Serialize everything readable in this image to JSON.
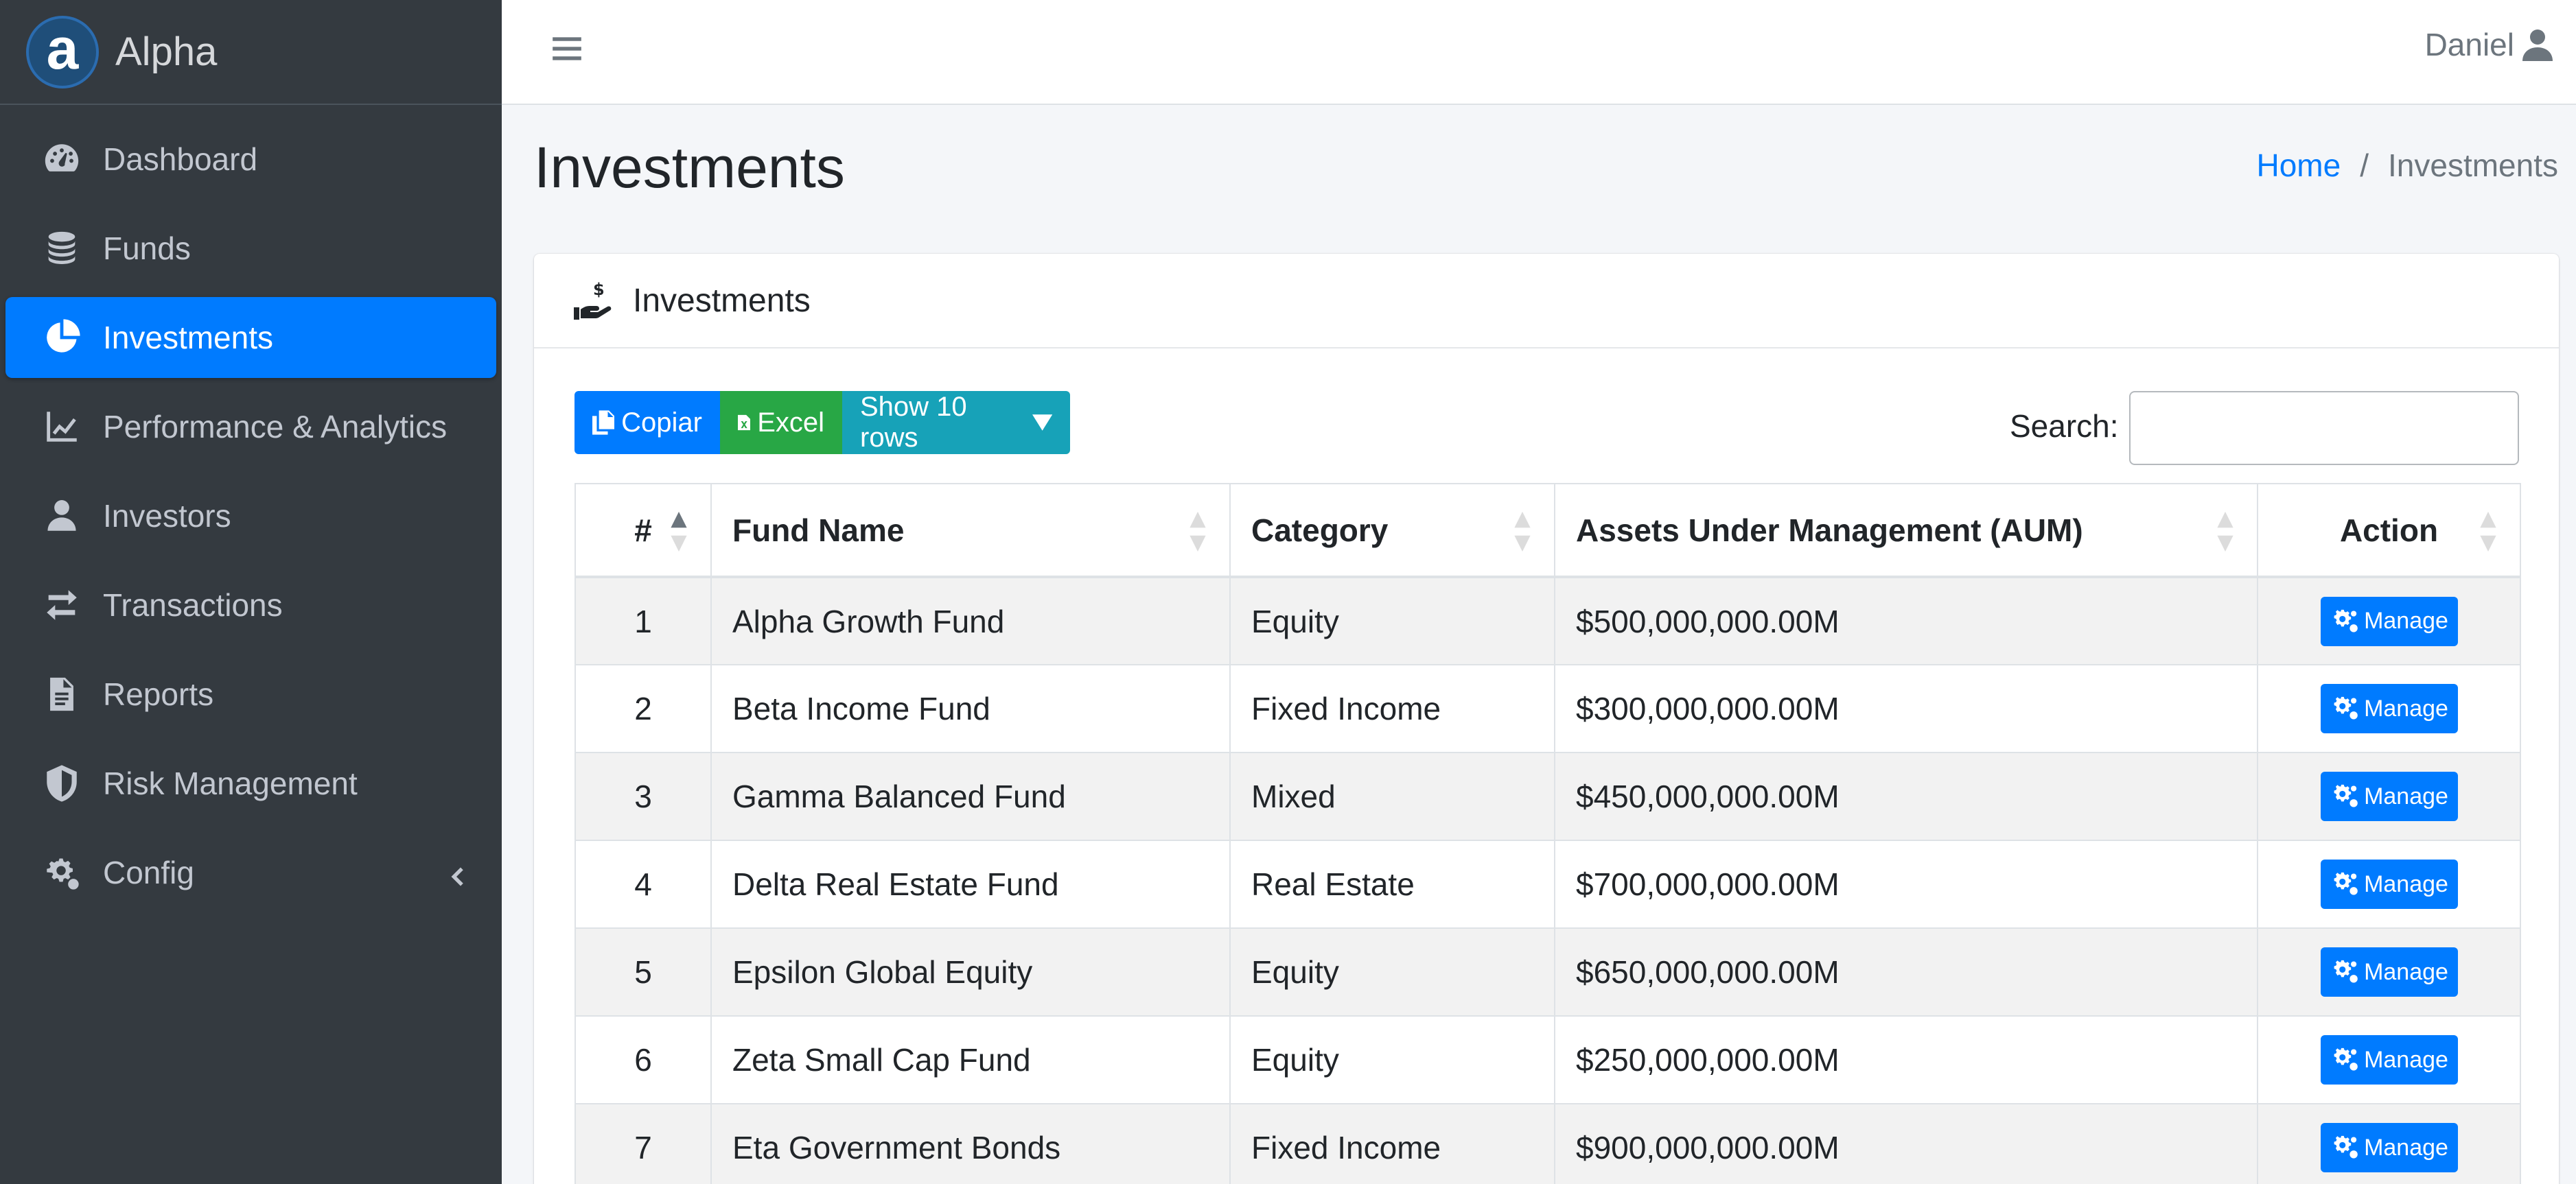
{
  "brand": {
    "letter": "a",
    "name": "Alpha"
  },
  "sidebar": {
    "items": [
      {
        "label": "Dashboard",
        "icon": "tachometer-icon"
      },
      {
        "label": "Funds",
        "icon": "coins-icon"
      },
      {
        "label": "Investments",
        "icon": "pie-chart-icon",
        "active": true
      },
      {
        "label": "Performance & Analytics",
        "icon": "line-chart-icon"
      },
      {
        "label": "Investors",
        "icon": "user-icon"
      },
      {
        "label": "Transactions",
        "icon": "exchange-icon"
      },
      {
        "label": "Reports",
        "icon": "file-icon"
      },
      {
        "label": "Risk Management",
        "icon": "shield-icon"
      },
      {
        "label": "Config",
        "icon": "gears-icon",
        "has_submenu": true
      }
    ]
  },
  "topbar": {
    "user_name": "Daniel"
  },
  "page": {
    "title": "Investments"
  },
  "breadcrumb": {
    "home": "Home",
    "separator": "/",
    "current": "Investments"
  },
  "card": {
    "title": "Investments"
  },
  "toolbar": {
    "copy_label": "Copiar",
    "excel_label": "Excel",
    "rows_label": "Show 10 rows"
  },
  "search": {
    "label": "Search:",
    "value": "",
    "placeholder": ""
  },
  "table": {
    "headers": [
      "#",
      "Fund Name",
      "Category",
      "Assets Under Management (AUM)",
      "Action"
    ],
    "rows": [
      {
        "num": "1",
        "fund": "Alpha Growth Fund",
        "category": "Equity",
        "aum": "$500,000,000.00M",
        "action": "Manage"
      },
      {
        "num": "2",
        "fund": "Beta Income Fund",
        "category": "Fixed Income",
        "aum": "$300,000,000.00M",
        "action": "Manage"
      },
      {
        "num": "3",
        "fund": "Gamma Balanced Fund",
        "category": "Mixed",
        "aum": "$450,000,000.00M",
        "action": "Manage"
      },
      {
        "num": "4",
        "fund": "Delta Real Estate Fund",
        "category": "Real Estate",
        "aum": "$700,000,000.00M",
        "action": "Manage"
      },
      {
        "num": "5",
        "fund": "Epsilon Global Equity",
        "category": "Equity",
        "aum": "$650,000,000.00M",
        "action": "Manage"
      },
      {
        "num": "6",
        "fund": "Zeta Small Cap Fund",
        "category": "Equity",
        "aum": "$250,000,000.00M",
        "action": "Manage"
      },
      {
        "num": "7",
        "fund": "Eta Government Bonds",
        "category": "Fixed Income",
        "aum": "$900,000,000.00M",
        "action": "Manage"
      }
    ]
  },
  "colors": {
    "sidebar_bg": "#343a40",
    "primary": "#007bff",
    "success": "#28a745",
    "info": "#17a2b8"
  }
}
